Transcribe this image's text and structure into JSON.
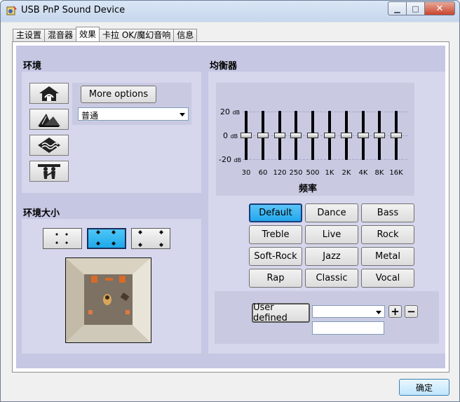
{
  "window": {
    "title": "USB PnP Sound Device"
  },
  "tabs": [
    {
      "label": "主设置"
    },
    {
      "label": "混音器"
    },
    {
      "label": "效果",
      "active": true
    },
    {
      "label": "卡拉 OK/魔幻音响"
    },
    {
      "label": "信息"
    }
  ],
  "environment": {
    "title": "环境",
    "icons": [
      "house-icon",
      "opera-house-icon",
      "water-icon",
      "people-icon"
    ],
    "more_options_label": "More options",
    "preset_select": "普通"
  },
  "environment_size": {
    "title": "环境大小",
    "options": [
      "small-room-icon",
      "medium-room-icon",
      "large-room-icon"
    ],
    "selected_index": 1
  },
  "equalizer": {
    "title": "均衡器",
    "db_labels": {
      "top": "20",
      "mid": "0",
      "bottom": "-20",
      "unit": "dB"
    },
    "bands": [
      "30",
      "60",
      "120",
      "250",
      "500",
      "1K",
      "2K",
      "4K",
      "8K",
      "16K"
    ],
    "band_levels_db": [
      0,
      0,
      0,
      0,
      0,
      0,
      0,
      0,
      0,
      0
    ],
    "axis_label": "频率",
    "presets": [
      "Default",
      "Dance",
      "Bass",
      "Treble",
      "Live",
      "Rock",
      "Soft-Rock",
      "Jazz",
      "Metal",
      "Rap",
      "Classic",
      "Vocal"
    ],
    "selected_preset": "Default",
    "user_defined_label": "User defined",
    "user_defined_select": "",
    "add_symbol": "+",
    "remove_symbol": "−",
    "name_input": ""
  },
  "ok_label": "确定"
}
